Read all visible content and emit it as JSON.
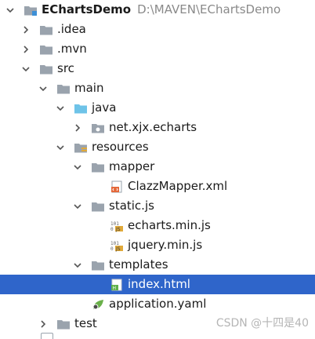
{
  "project": {
    "name": "EChartsDemo",
    "path": "D:\\MAVEN\\EChartsDemo"
  },
  "tree": {
    "idea": ".idea",
    "mvn": ".mvn",
    "src": "src",
    "main": "main",
    "java": "java",
    "package": "net.xjx.echarts",
    "resources": "resources",
    "mapper": "mapper",
    "mapper_file": "ClazzMapper.xml",
    "static": "static.js",
    "echarts_file": "echarts.min.js",
    "jquery_file": "jquery.min.js",
    "templates": "templates",
    "index_file": "index.html",
    "app_yaml": "application.yaml",
    "test": "test"
  },
  "watermark": "CSDN @十四是40",
  "colors": {
    "selected": "#2f65ca",
    "folder": "#9aa3ad",
    "java_folder": "#6ec3e8"
  },
  "selected_item": "index.html"
}
